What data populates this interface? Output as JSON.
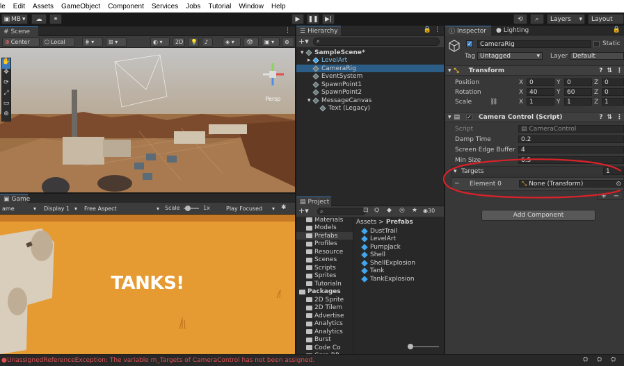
{
  "menu": [
    "le",
    "Edit",
    "Assets",
    "GameObject",
    "Component",
    "Services",
    "Jobs",
    "Tutorial",
    "Window",
    "Help"
  ],
  "toolbar": {
    "account": "MB",
    "layers": "Layers",
    "layout": "Layout"
  },
  "scene": {
    "tab": "Scene",
    "pivot": "Center",
    "space": "Local",
    "mode2d": "2D",
    "persp": "Persp"
  },
  "game": {
    "tab": "Game",
    "display_prefix": "ame",
    "display": "Display 1",
    "aspect": "Free Aspect",
    "scale_label": "Scale",
    "scale_value": "1x",
    "play_mode": "Play Focused",
    "overlay_text": "TANKS!"
  },
  "hierarchy": {
    "tab": "Hierarchy",
    "items": [
      {
        "label": "SampleScene*",
        "indent": 0,
        "kind": "scene"
      },
      {
        "label": "LevelArt",
        "indent": 1,
        "kind": "prefab"
      },
      {
        "label": "CameraRig",
        "indent": 1,
        "kind": "object",
        "selected": true
      },
      {
        "label": "EventSystem",
        "indent": 1,
        "kind": "object"
      },
      {
        "label": "SpawnPoint1",
        "indent": 1,
        "kind": "object"
      },
      {
        "label": "SpawnPoint2",
        "indent": 1,
        "kind": "object"
      },
      {
        "label": "MessageCanvas",
        "indent": 1,
        "kind": "object"
      },
      {
        "label": "Text (Legacy)",
        "indent": 2,
        "kind": "object"
      }
    ]
  },
  "project": {
    "tab": "Project",
    "count": "30",
    "breadcrumb": {
      "root": "Assets",
      "sep": ">",
      "current": "Prefabs"
    },
    "folders": [
      "Materials",
      "Models",
      "Prefabs",
      "Profiles",
      "Resource",
      "Scenes",
      "Scripts",
      "Sprites",
      "Tutorialn"
    ],
    "packages_label": "Packages",
    "packages": [
      "2D Sprite",
      "2D Tilem",
      "Advertise",
      "Analytics",
      "Analytics",
      "Burst",
      "Code Co",
      "Core RP"
    ],
    "assets": [
      "DustTrail",
      "LevelArt",
      "PumpJack",
      "Shell",
      "ShellExplosion",
      "Tank",
      "TankExplosion"
    ]
  },
  "inspector": {
    "tab": "Inspector",
    "tab2": "Lighting",
    "object_name": "CameraRig",
    "static_label": "Static",
    "tag_label": "Tag",
    "tag": "Untagged",
    "layer_label": "Layer",
    "layer": "Default",
    "transform": {
      "title": "Transform",
      "rows": [
        {
          "label": "Position",
          "x": "0",
          "y": "0",
          "z": "0"
        },
        {
          "label": "Rotation",
          "x": "40",
          "y": "60",
          "z": "0"
        },
        {
          "label": "Scale",
          "x": "1",
          "y": "1",
          "z": "1"
        }
      ],
      "axis": {
        "x": "X",
        "y": "Y",
        "z": "Z"
      }
    },
    "camera_control": {
      "title": "Camera Control (Script)",
      "script_label": "Script",
      "script_value": "CameraControl",
      "damp_label": "Damp Time",
      "damp_value": "0.2",
      "edge_label": "Screen Edge Buffer",
      "edge_value": "4",
      "min_label": "Min Size",
      "min_value": "6.5",
      "targets_label": "Targets",
      "targets_count": "1",
      "element_label": "Element 0",
      "element_value": "None (Transform)"
    },
    "add_component": "Add Component"
  },
  "status": {
    "message": "UnassignedReferenceException: The variable m_Targets of CameraControl has not been assigned.",
    "color": "#e05050"
  },
  "colors": {
    "annotation": "#d8222a",
    "selection": "#2c5d87",
    "accent": "#3a79bb"
  }
}
